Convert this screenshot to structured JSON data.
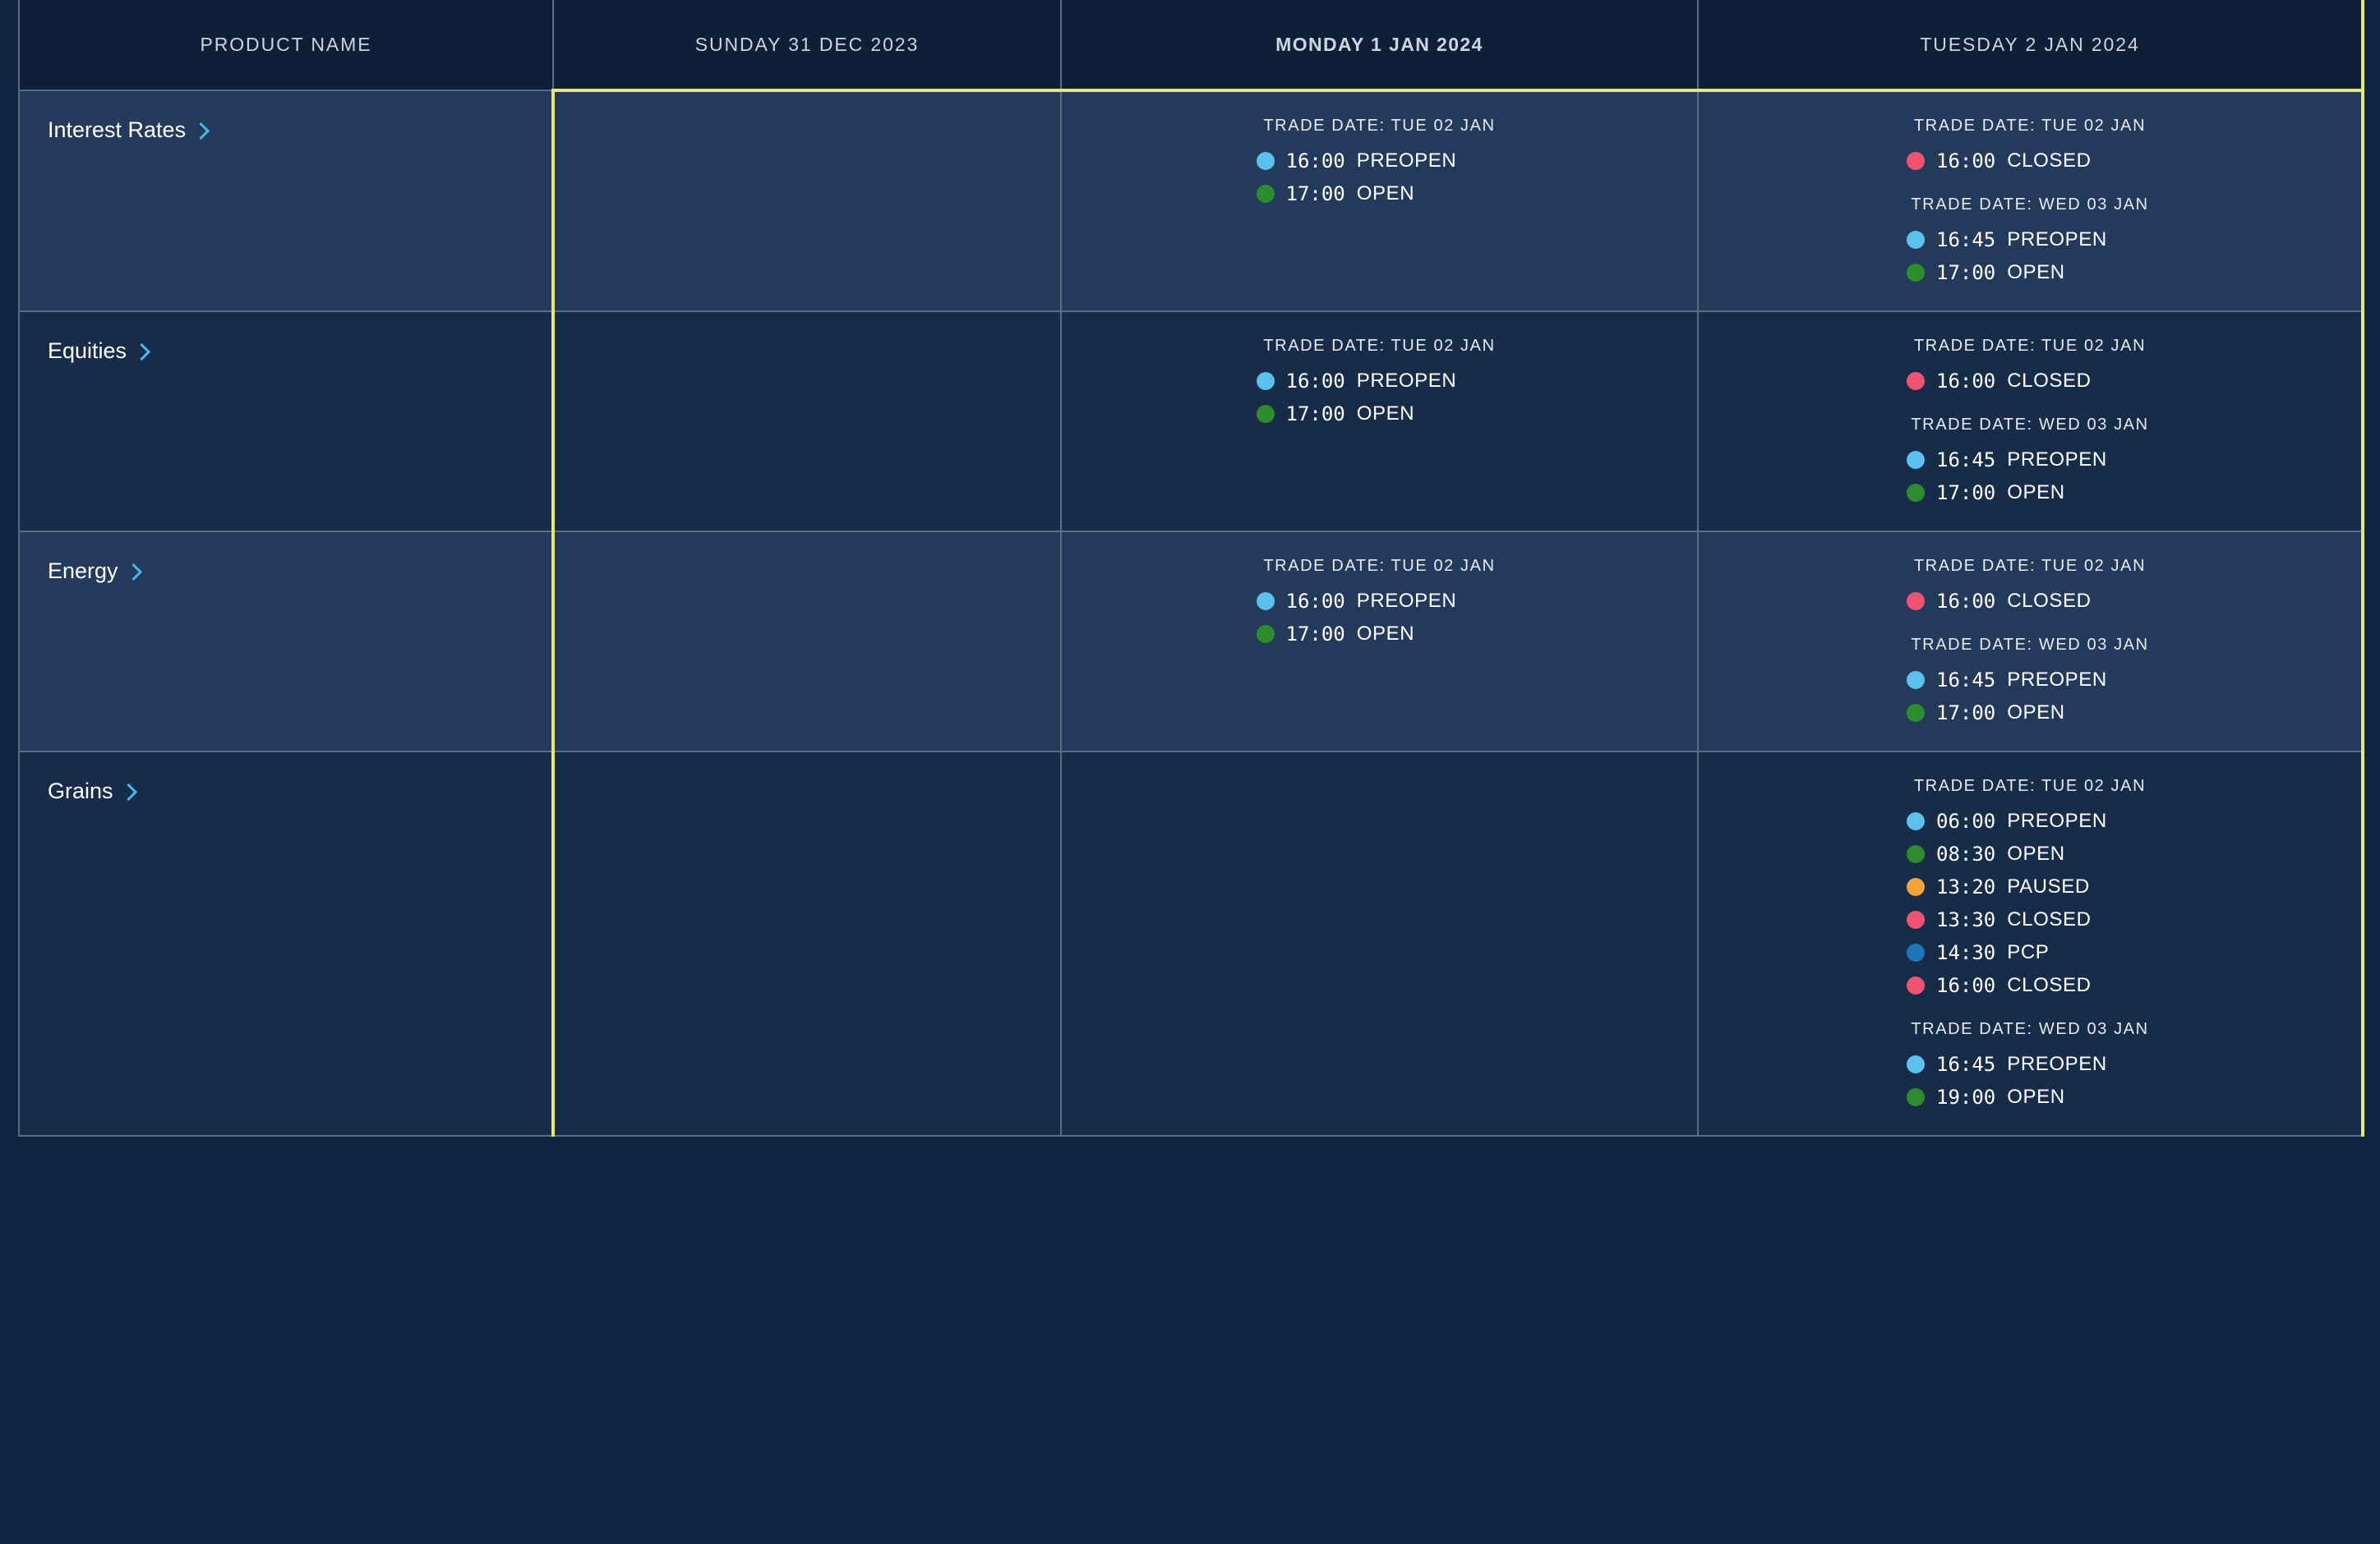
{
  "table": {
    "columns": [
      {
        "key": "product",
        "label": "PRODUCT NAME",
        "highlighted": false
      },
      {
        "key": "sunday",
        "label": "SUNDAY 31 DEC 2023",
        "highlighted": false
      },
      {
        "key": "monday",
        "label": "MONDAY 1 JAN 2024",
        "highlighted": true
      },
      {
        "key": "tuesday",
        "label": "TUESDAY 2 JAN 2024",
        "highlighted": false
      }
    ]
  },
  "status_colors": {
    "PREOPEN": "#5bc0ed",
    "OPEN": "#2d8c2d",
    "CLOSED": "#ef5370",
    "PAUSED": "#f2a33c",
    "PCP": "#1f74b8"
  },
  "accent": {
    "highlight_border": "#e9e96a",
    "chevron": "#49b6ef",
    "grid_line": "#5c6d82",
    "header_bg": "#101f38",
    "row_odd_bg": "#243a5a",
    "row_even_bg": "#162c49",
    "page_bg": "#0e2440"
  },
  "rows": [
    {
      "product": "Interest Rates",
      "sunday": [],
      "monday": [
        {
          "trade_date": "TRADE DATE: TUE 02 JAN",
          "events": [
            {
              "time": "16:00",
              "status": "PREOPEN"
            },
            {
              "time": "17:00",
              "status": "OPEN"
            }
          ]
        }
      ],
      "tuesday": [
        {
          "trade_date": "TRADE DATE: TUE 02 JAN",
          "events": [
            {
              "time": "16:00",
              "status": "CLOSED"
            }
          ]
        },
        {
          "trade_date": "TRADE DATE: WED 03 JAN",
          "events": [
            {
              "time": "16:45",
              "status": "PREOPEN"
            },
            {
              "time": "17:00",
              "status": "OPEN"
            }
          ]
        }
      ]
    },
    {
      "product": "Equities",
      "sunday": [],
      "monday": [
        {
          "trade_date": "TRADE DATE: TUE 02 JAN",
          "events": [
            {
              "time": "16:00",
              "status": "PREOPEN"
            },
            {
              "time": "17:00",
              "status": "OPEN"
            }
          ]
        }
      ],
      "tuesday": [
        {
          "trade_date": "TRADE DATE: TUE 02 JAN",
          "events": [
            {
              "time": "16:00",
              "status": "CLOSED"
            }
          ]
        },
        {
          "trade_date": "TRADE DATE: WED 03 JAN",
          "events": [
            {
              "time": "16:45",
              "status": "PREOPEN"
            },
            {
              "time": "17:00",
              "status": "OPEN"
            }
          ]
        }
      ]
    },
    {
      "product": "Energy",
      "sunday": [],
      "monday": [
        {
          "trade_date": "TRADE DATE: TUE 02 JAN",
          "events": [
            {
              "time": "16:00",
              "status": "PREOPEN"
            },
            {
              "time": "17:00",
              "status": "OPEN"
            }
          ]
        }
      ],
      "tuesday": [
        {
          "trade_date": "TRADE DATE: TUE 02 JAN",
          "events": [
            {
              "time": "16:00",
              "status": "CLOSED"
            }
          ]
        },
        {
          "trade_date": "TRADE DATE: WED 03 JAN",
          "events": [
            {
              "time": "16:45",
              "status": "PREOPEN"
            },
            {
              "time": "17:00",
              "status": "OPEN"
            }
          ]
        }
      ]
    },
    {
      "product": "Grains",
      "sunday": [],
      "monday": [],
      "tuesday": [
        {
          "trade_date": "TRADE DATE: TUE 02 JAN",
          "events": [
            {
              "time": "06:00",
              "status": "PREOPEN"
            },
            {
              "time": "08:30",
              "status": "OPEN"
            },
            {
              "time": "13:20",
              "status": "PAUSED"
            },
            {
              "time": "13:30",
              "status": "CLOSED"
            },
            {
              "time": "14:30",
              "status": "PCP"
            },
            {
              "time": "16:00",
              "status": "CLOSED"
            }
          ]
        },
        {
          "trade_date": "TRADE DATE: WED 03 JAN",
          "events": [
            {
              "time": "16:45",
              "status": "PREOPEN"
            },
            {
              "time": "19:00",
              "status": "OPEN"
            }
          ]
        }
      ]
    }
  ]
}
